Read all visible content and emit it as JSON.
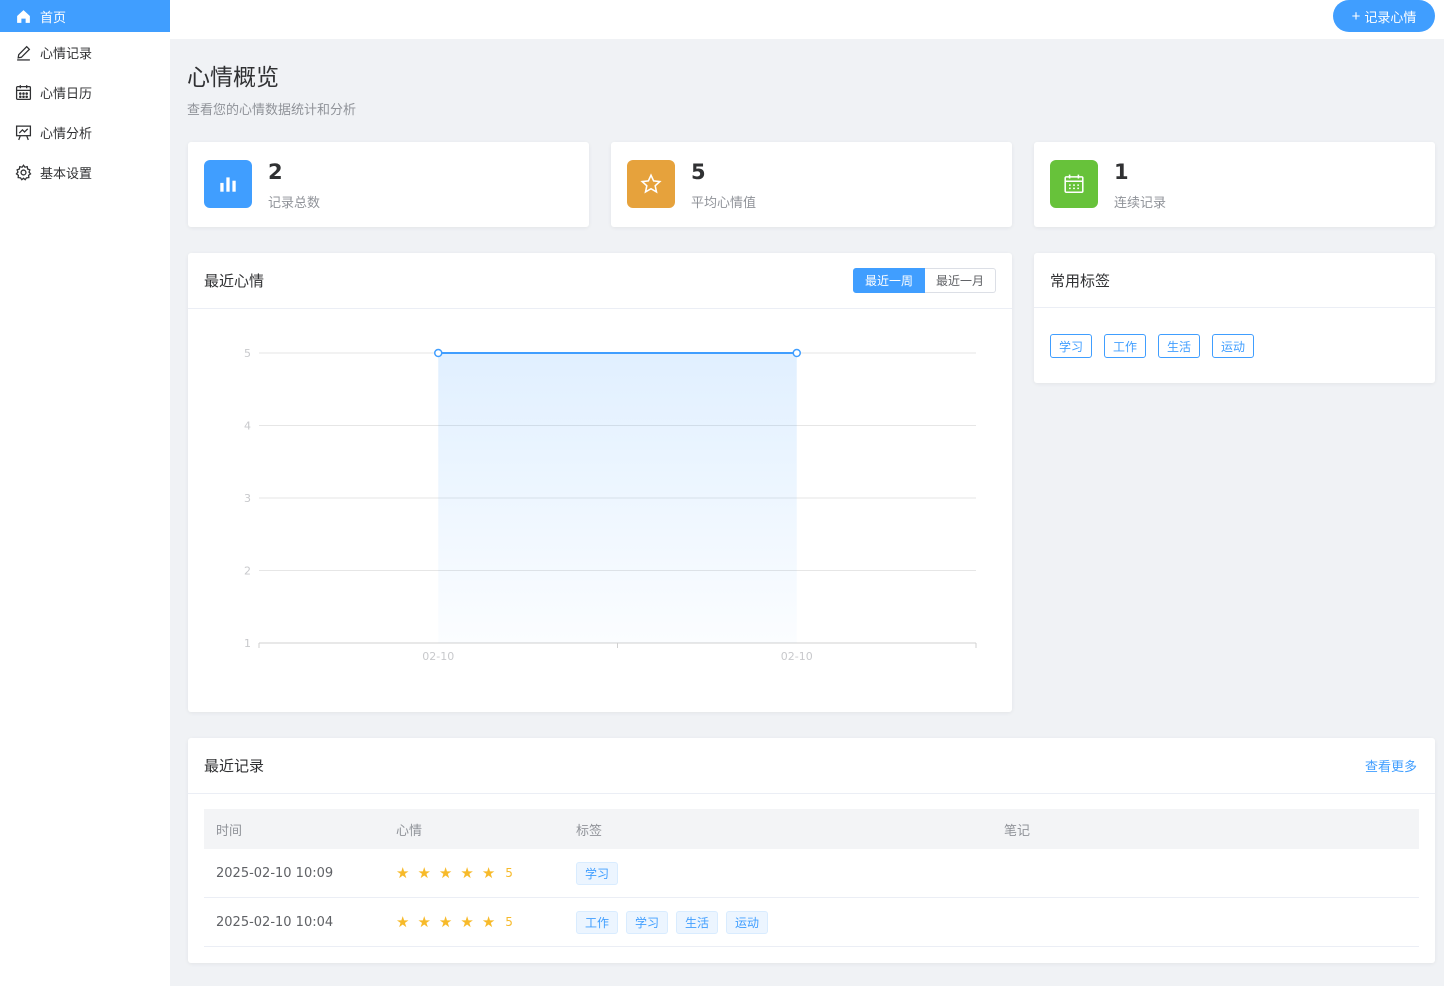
{
  "sidebar": {
    "items": [
      {
        "label": "首页",
        "icon": "home-icon",
        "active": true
      },
      {
        "label": "心情记录",
        "icon": "edit-icon"
      },
      {
        "label": "心情日历",
        "icon": "calendar-icon"
      },
      {
        "label": "心情分析",
        "icon": "presentation-chart-icon"
      },
      {
        "label": "基本设置",
        "icon": "gear-icon"
      }
    ]
  },
  "header": {
    "record_button": "记录心情"
  },
  "page": {
    "title": "心情概览",
    "subtitle": "查看您的心情数据统计和分析"
  },
  "stats": [
    {
      "value": "2",
      "label": "记录总数",
      "icon": "bar-chart-icon",
      "color": "#409eff"
    },
    {
      "value": "5",
      "label": "平均心情值",
      "icon": "star-icon",
      "color": "#e6a23c"
    },
    {
      "value": "1",
      "label": "连续记录",
      "icon": "calendar-icon",
      "color": "#67c23a"
    }
  ],
  "recent_mood": {
    "title": "最近心情",
    "ranges": [
      "最近一周",
      "最近一月"
    ],
    "active_range": "最近一周"
  },
  "chart_data": {
    "type": "area",
    "x": [
      "02-10",
      "02-10"
    ],
    "series": [
      {
        "values": [
          5,
          5
        ]
      }
    ],
    "ylim": [
      1,
      5
    ],
    "yticks": [
      "1",
      "2",
      "3",
      "4",
      "5"
    ],
    "grid": true,
    "color": "#409eff"
  },
  "tags_card": {
    "title": "常用标签",
    "tags": [
      "学习",
      "工作",
      "生活",
      "运动"
    ]
  },
  "recent_records": {
    "title": "最近记录",
    "more_link": "查看更多",
    "columns": [
      "时间",
      "心情",
      "标签",
      "笔记"
    ],
    "rows": [
      {
        "time": "2025-02-10 10:09",
        "mood": 5,
        "mood_label": "5",
        "tags": [
          "学习"
        ],
        "note": ""
      },
      {
        "time": "2025-02-10 10:04",
        "mood": 5,
        "mood_label": "5",
        "tags": [
          "工作",
          "学习",
          "生活",
          "运动"
        ],
        "note": ""
      }
    ]
  }
}
